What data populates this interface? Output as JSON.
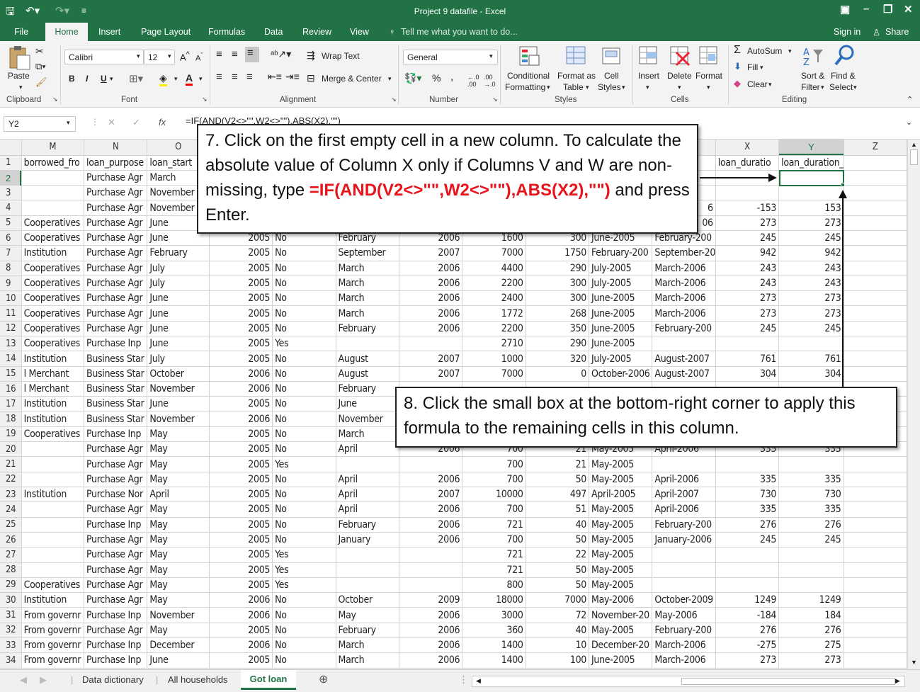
{
  "app": {
    "title": "Project 9 datafile - Excel"
  },
  "menu": {
    "items": [
      "File",
      "Home",
      "Insert",
      "Page Layout",
      "Formulas",
      "Data",
      "Review",
      "View"
    ],
    "tell_me": "Tell me what you want to do...",
    "sign_in": "Sign in",
    "share": "Share"
  },
  "ribbon": {
    "clipboard": {
      "paste": "Paste",
      "label": "Clipboard"
    },
    "font": {
      "name": "Calibri",
      "size": "12",
      "bold": "B",
      "italic": "I",
      "underline": "U",
      "label": "Font"
    },
    "alignment": {
      "wrap": "Wrap Text",
      "merge": "Merge & Center",
      "label": "Alignment"
    },
    "number": {
      "format": "General",
      "percent": "%",
      "comma": ",",
      "label": "Number"
    },
    "styles": {
      "cond": "Conditional",
      "cond2": "Formatting",
      "format_as": "Format as",
      "format_as2": "Table",
      "cell": "Cell",
      "cell2": "Styles",
      "label": "Styles"
    },
    "cells": {
      "insert": "Insert",
      "delete": "Delete",
      "format": "Format",
      "label": "Cells"
    },
    "editing": {
      "autosum": "AutoSum",
      "fill": "Fill",
      "clear": "Clear",
      "sort": "Sort &",
      "sort2": "Filter",
      "find": "Find &",
      "find2": "Select",
      "label": "Editing"
    }
  },
  "formula_bar": {
    "name_box": "Y2",
    "fx": "fx",
    "formula": "=IF(AND(V2<>\"\",W2<>\"\"),ABS(X2),\"\")"
  },
  "columns": [
    "M",
    "N",
    "O",
    "P",
    "Q",
    "R",
    "S",
    "T",
    "U",
    "V",
    "W",
    "X",
    "Y",
    "Z"
  ],
  "rows": [
    [
      "borrowed_fro",
      "loan_purpose",
      "loan_start",
      "",
      "",
      "",
      "",
      "",
      "",
      "",
      "",
      "loan_duratio",
      "loan_duration_recoded",
      ""
    ],
    [
      "",
      "Purchase Agr",
      "March",
      "",
      "",
      "",
      "",
      "",
      "",
      "",
      "",
      "",
      "",
      ""
    ],
    [
      "",
      "Purchase Agr",
      "November",
      "",
      "",
      "",
      "",
      "",
      "",
      "",
      "",
      "",
      "",
      ""
    ],
    [
      "",
      "Purchase Agr",
      "November",
      "",
      "",
      "",
      "",
      "",
      "",
      "",
      "6",
      "-153",
      "153",
      ""
    ],
    [
      "Cooperatives",
      "Purchase Agr",
      "June",
      "",
      "",
      "",
      "",
      "",
      "",
      "",
      "06",
      "273",
      "273",
      ""
    ],
    [
      "Cooperatives",
      "Purchase Agr",
      "June",
      "2005",
      "No",
      "February",
      "2006",
      "1600",
      "300",
      "June-2005",
      "February-200",
      "245",
      "245",
      ""
    ],
    [
      "Institution",
      "Purchase Agr",
      "February",
      "2005",
      "No",
      "September",
      "2007",
      "7000",
      "1750",
      "February-200",
      "September-20",
      "942",
      "942",
      ""
    ],
    [
      "Cooperatives",
      "Purchase Agr",
      "July",
      "2005",
      "No",
      "March",
      "2006",
      "4400",
      "290",
      "July-2005",
      "March-2006",
      "243",
      "243",
      ""
    ],
    [
      "Cooperatives",
      "Purchase Agr",
      "July",
      "2005",
      "No",
      "March",
      "2006",
      "2200",
      "300",
      "July-2005",
      "March-2006",
      "243",
      "243",
      ""
    ],
    [
      "Cooperatives",
      "Purchase Agr",
      "June",
      "2005",
      "No",
      "March",
      "2006",
      "2400",
      "300",
      "June-2005",
      "March-2006",
      "273",
      "273",
      ""
    ],
    [
      "Cooperatives",
      "Purchase Agr",
      "June",
      "2005",
      "No",
      "March",
      "2006",
      "1772",
      "268",
      "June-2005",
      "March-2006",
      "273",
      "273",
      ""
    ],
    [
      "Cooperatives",
      "Purchase Agr",
      "June",
      "2005",
      "No",
      "February",
      "2006",
      "2200",
      "350",
      "June-2005",
      "February-200",
      "245",
      "245",
      ""
    ],
    [
      "Cooperatives",
      "Purchase Inp",
      "June",
      "2005",
      "Yes",
      "",
      "",
      "2710",
      "290",
      "June-2005",
      "",
      "",
      "",
      ""
    ],
    [
      "Institution",
      "Business Star",
      "July",
      "2005",
      "No",
      "August",
      "2007",
      "1000",
      "320",
      "July-2005",
      "August-2007",
      "761",
      "761",
      ""
    ],
    [
      "l Merchant",
      "Business Star",
      "October",
      "2006",
      "No",
      "August",
      "2007",
      "7000",
      "0",
      "October-2006",
      "August-2007",
      "304",
      "304",
      ""
    ],
    [
      "l Merchant",
      "Business Star",
      "November",
      "2006",
      "No",
      "February",
      "",
      "",
      "",
      "",
      "",
      "",
      "",
      ""
    ],
    [
      "Institution",
      "Business Star",
      "June",
      "2005",
      "No",
      "June",
      "",
      "",
      "",
      "",
      "",
      "",
      "",
      ""
    ],
    [
      "Institution",
      "Business Star",
      "November",
      "2006",
      "No",
      "November",
      "",
      "",
      "",
      "",
      "",
      "",
      "",
      ""
    ],
    [
      "Cooperatives",
      "Purchase Inp",
      "May",
      "2005",
      "No",
      "March",
      "",
      "",
      "",
      "",
      "",
      "",
      "",
      ""
    ],
    [
      "",
      "Purchase Agr",
      "May",
      "2005",
      "No",
      "April",
      "2006",
      "700",
      "21",
      "May-2005",
      "April-2006",
      "335",
      "335",
      ""
    ],
    [
      "",
      "Purchase Agr",
      "May",
      "2005",
      "Yes",
      "",
      "",
      "700",
      "21",
      "May-2005",
      "",
      "",
      "",
      ""
    ],
    [
      "",
      "Purchase Agr",
      "May",
      "2005",
      "No",
      "April",
      "2006",
      "700",
      "50",
      "May-2005",
      "April-2006",
      "335",
      "335",
      ""
    ],
    [
      "Institution",
      "Purchase Nor",
      "April",
      "2005",
      "No",
      "April",
      "2007",
      "10000",
      "497",
      "April-2005",
      "April-2007",
      "730",
      "730",
      ""
    ],
    [
      "",
      "Purchase Agr",
      "May",
      "2005",
      "No",
      "April",
      "2006",
      "700",
      "51",
      "May-2005",
      "April-2006",
      "335",
      "335",
      ""
    ],
    [
      "",
      "Purchase Inp",
      "May",
      "2005",
      "No",
      "February",
      "2006",
      "721",
      "40",
      "May-2005",
      "February-200",
      "276",
      "276",
      ""
    ],
    [
      "",
      "Purchase Agr",
      "May",
      "2005",
      "No",
      "January",
      "2006",
      "700",
      "50",
      "May-2005",
      "January-2006",
      "245",
      "245",
      ""
    ],
    [
      "",
      "Purchase Agr",
      "May",
      "2005",
      "Yes",
      "",
      "",
      "721",
      "22",
      "May-2005",
      "",
      "",
      "",
      ""
    ],
    [
      "",
      "Purchase Agr",
      "May",
      "2005",
      "Yes",
      "",
      "",
      "721",
      "50",
      "May-2005",
      "",
      "",
      "",
      ""
    ],
    [
      "Cooperatives",
      "Purchase Agr",
      "May",
      "2005",
      "Yes",
      "",
      "",
      "800",
      "50",
      "May-2005",
      "",
      "",
      "",
      ""
    ],
    [
      "Institution",
      "Purchase Agr",
      "May",
      "2006",
      "No",
      "October",
      "2009",
      "18000",
      "7000",
      "May-2006",
      "October-2009",
      "1249",
      "1249",
      ""
    ],
    [
      "From governr",
      "Purchase Inp",
      "November",
      "2006",
      "No",
      "May",
      "2006",
      "3000",
      "72",
      "November-20",
      "May-2006",
      "-184",
      "184",
      ""
    ],
    [
      "From governr",
      "Purchase Agr",
      "May",
      "2005",
      "No",
      "February",
      "2006",
      "360",
      "40",
      "May-2005",
      "February-200",
      "276",
      "276",
      ""
    ],
    [
      "From governr",
      "Purchase Inp",
      "December",
      "2006",
      "No",
      "March",
      "2006",
      "1400",
      "10",
      "December-20",
      "March-2006",
      "-275",
      "275",
      ""
    ],
    [
      "From governr",
      "Purchase Inp",
      "June",
      "2005",
      "No",
      "March",
      "2006",
      "1400",
      "100",
      "June-2005",
      "March-2006",
      "273",
      "273",
      ""
    ]
  ],
  "sheets": [
    "Data dictionary",
    "All households",
    "Got loan"
  ],
  "callout7": {
    "text1": "7. Click on the first empty cell in a new column. To calculate the absolute value of Column X only if Columns V and W are non-missing, type ",
    "formula": "=IF(AND(V2<>\"\",W2<>\"\"),ABS(X2),\"\")",
    "text2": " and press Enter."
  },
  "callout8": {
    "text": "8. Click the small box at the bottom-right corner to apply this formula to the remaining cells in this column."
  },
  "colors": {
    "excel_green": "#217346",
    "highlight_red": "#e8141c"
  }
}
